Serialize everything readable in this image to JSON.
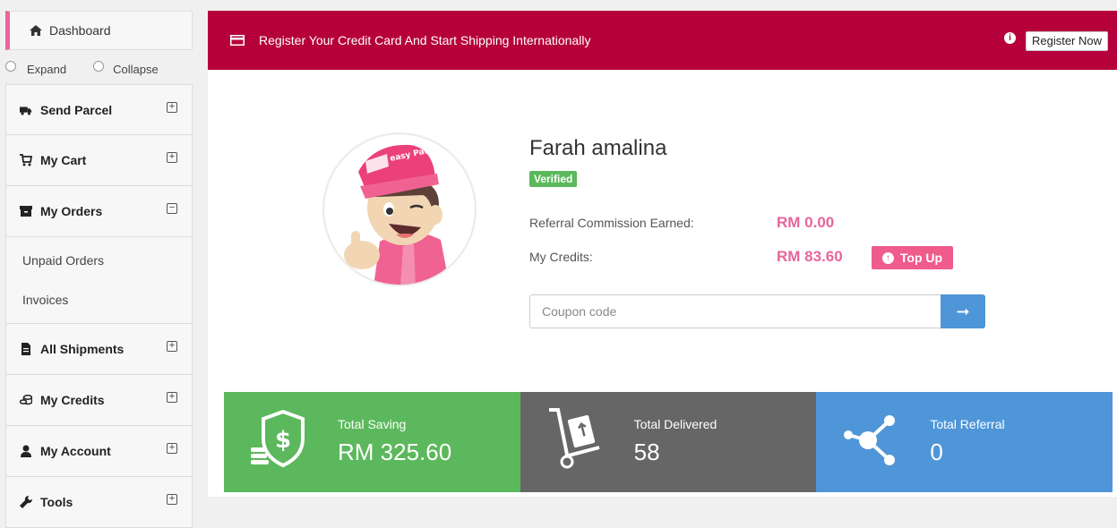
{
  "sidebar": {
    "dashboard_label": "Dashboard",
    "expand_label": "Expand",
    "collapse_label": "Collapse",
    "items": [
      {
        "label": "Send Parcel",
        "icon": "truck-icon",
        "toggle": "+"
      },
      {
        "label": "My Cart",
        "icon": "cart-icon",
        "toggle": "+"
      },
      {
        "label": "My Orders",
        "icon": "box-icon",
        "toggle": "−"
      },
      {
        "label": "All Shipments",
        "icon": "document-icon",
        "toggle": "+"
      },
      {
        "label": "My Credits",
        "icon": "coins-icon",
        "toggle": "+"
      },
      {
        "label": "My Account",
        "icon": "user-icon",
        "toggle": "+"
      },
      {
        "label": "Tools",
        "icon": "wrench-icon",
        "toggle": "+"
      }
    ],
    "orders_sub": [
      "Unpaid Orders",
      "Invoices"
    ]
  },
  "banner": {
    "text": "Register Your Credit Card And Start Shipping Internationally",
    "button": "Register Now",
    "bg_color": "#b5003b"
  },
  "profile": {
    "name": "Farah amalina",
    "badge": "Verified",
    "commission_label": "Referral Commission Earned:",
    "commission_value": "RM 0.00",
    "credits_label": "My Credits:",
    "credits_value": "RM 83.60",
    "topup_label": "Top Up",
    "avatar_logo_text": "easy Parcel"
  },
  "coupon": {
    "placeholder": "Coupon code",
    "submit_icon": "arrow-right-icon"
  },
  "stats": [
    {
      "label": "Total Saving",
      "value": "RM 325.60",
      "color": "#5cb85c",
      "icon": "shield-dollar-icon"
    },
    {
      "label": "Total Delivered",
      "value": "58",
      "color": "#666666",
      "icon": "hand-truck-icon"
    },
    {
      "label": "Total Referral",
      "value": "0",
      "color": "#4f96d8",
      "icon": "share-icon"
    }
  ],
  "colors": {
    "accent": "#e8659b",
    "topup": "#ef5b8b"
  }
}
